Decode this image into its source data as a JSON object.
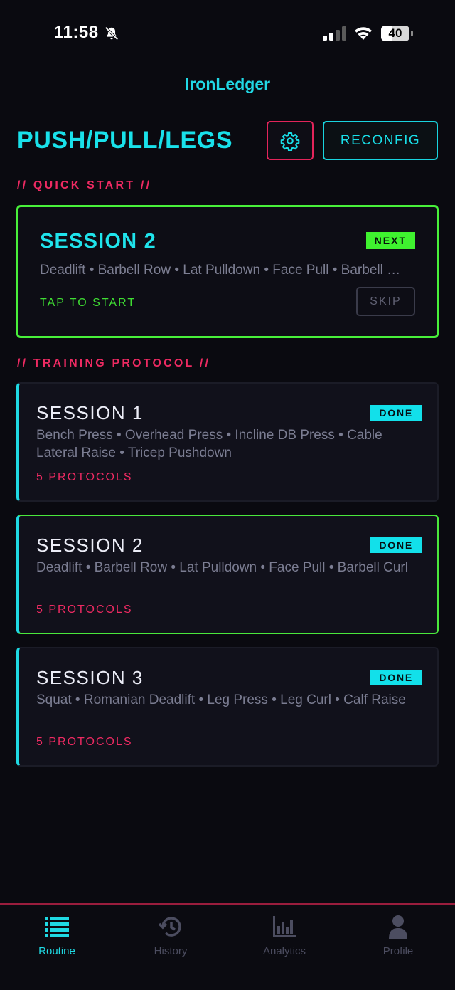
{
  "status": {
    "time": "11:58",
    "battery": "40",
    "battery_level": 0.4
  },
  "app": {
    "title": "IronLedger"
  },
  "routine": {
    "title": "PUSH/PULL/LEGS",
    "reconfig_label": "RECONFIG"
  },
  "quick_start": {
    "section_label": "// QUICK START //",
    "session_title": "SESSION 2",
    "badge": "NEXT",
    "exercises": "Deadlift • Barbell Row • Lat Pulldown • Face Pull • Barbell Curl",
    "tap_label": "TAP TO START",
    "skip_label": "SKIP"
  },
  "protocol": {
    "section_label": "// TRAINING PROTOCOL //",
    "sessions": [
      {
        "title": "SESSION 1",
        "badge": "DONE",
        "exercises": "Bench Press • Overhead Press • Incline DB Press • Cable Lateral Raise • Tricep Pushdown",
        "count": "5 PROTOCOLS"
      },
      {
        "title": "SESSION 2",
        "badge": "DONE",
        "exercises": "Deadlift • Barbell Row • Lat Pulldown • Face Pull • Barbell Curl",
        "count": "5 PROTOCOLS"
      },
      {
        "title": "SESSION 3",
        "badge": "DONE",
        "exercises": "Squat • Romanian Deadlift • Leg Press • Leg Curl • Calf Raise",
        "count": "5 PROTOCOLS"
      }
    ]
  },
  "nav": {
    "items": [
      {
        "label": "Routine",
        "icon": "list-icon"
      },
      {
        "label": "History",
        "icon": "history-icon"
      },
      {
        "label": "Analytics",
        "icon": "bar-chart-icon"
      },
      {
        "label": "Profile",
        "icon": "person-icon"
      }
    ]
  },
  "colors": {
    "accent_cyan": "#1fd9e3",
    "accent_pink": "#ee2a62",
    "accent_green": "#48f03a",
    "background": "#0a0a10"
  }
}
